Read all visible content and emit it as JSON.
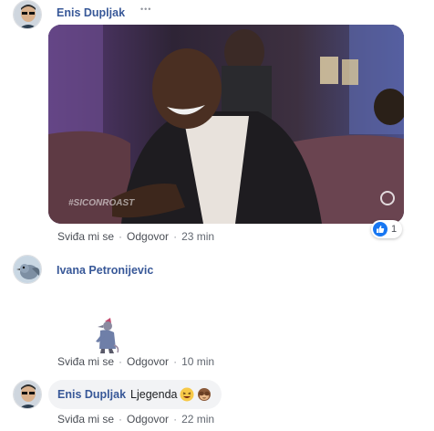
{
  "comments": [
    {
      "author": "Enis Dupljak",
      "more": "•••",
      "gif_watermark": "#SICONROAST",
      "like_label": "Sviđa mi se",
      "reply_label": "Odgovor",
      "time": "23 min",
      "reaction_count": "1",
      "reaction_type": "like",
      "avatar_icon": "user-avatar-sunglasses",
      "brand_color": "#385898"
    },
    {
      "author": "Ivana Petronijevic",
      "sticker_icon": "rat-detective-sticker",
      "like_label": "Sviđa mi se",
      "reply_label": "Odgovor",
      "time": "10 min",
      "avatar_icon": "user-avatar-bird"
    },
    {
      "author": "Enis Dupljak",
      "text": "Ljegenda",
      "emojis": [
        "laughing-emoji",
        "see-no-evil-monkey-emoji"
      ],
      "like_label": "Sviđa mi se",
      "reply_label": "Odgovor",
      "time": "22 min",
      "avatar_icon": "user-avatar-sunglasses"
    }
  ],
  "separator": "·"
}
